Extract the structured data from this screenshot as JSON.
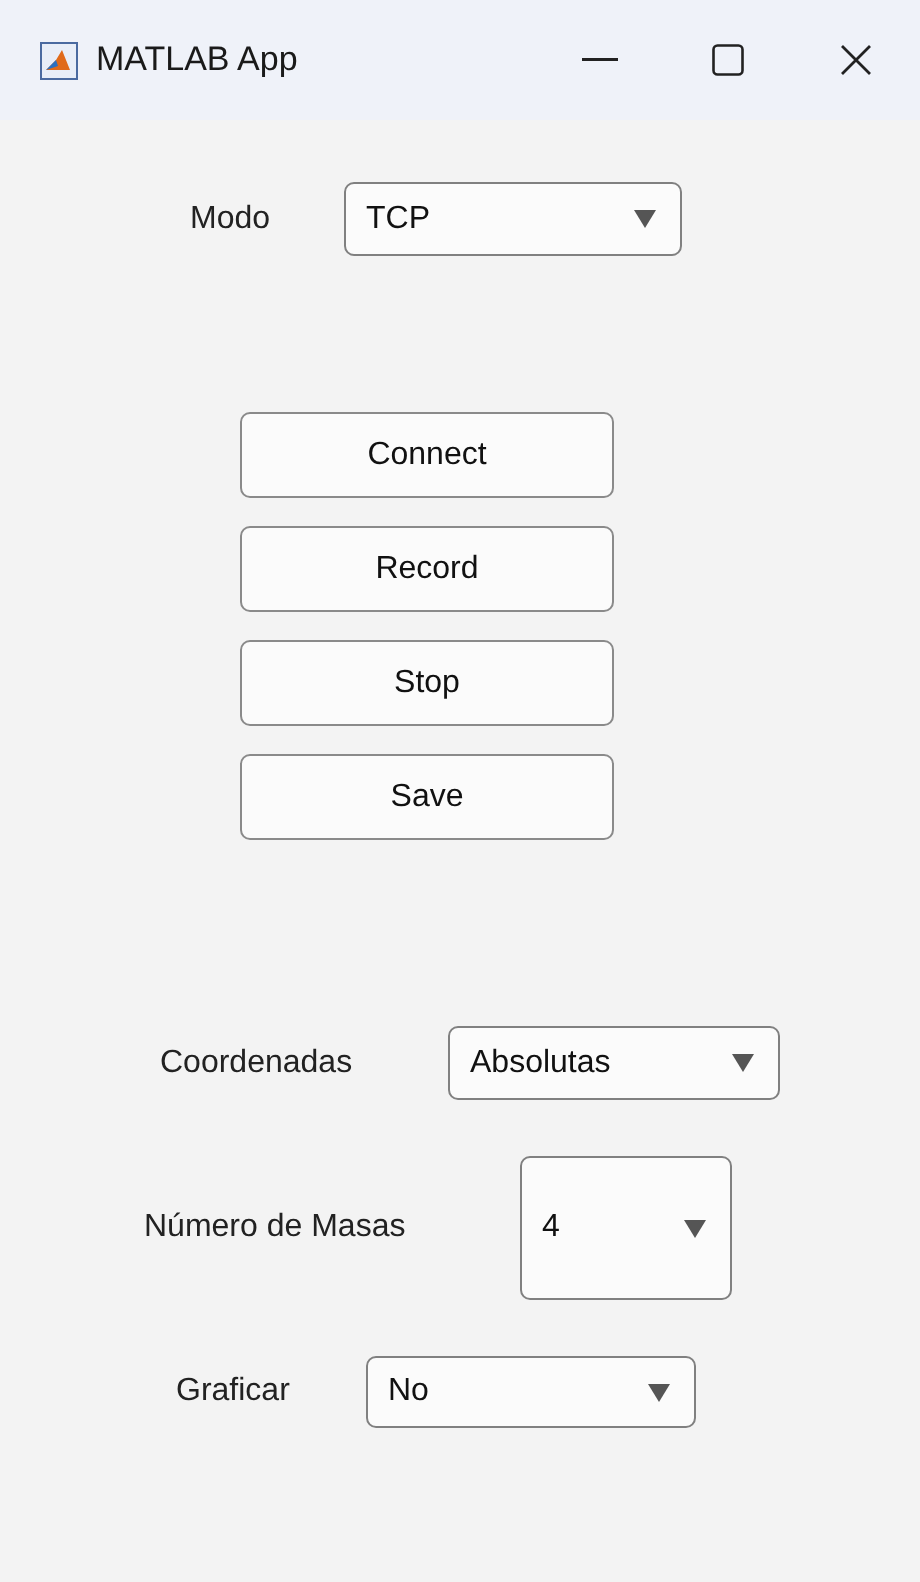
{
  "window": {
    "title": "MATLAB App"
  },
  "mode": {
    "label": "Modo",
    "value": "TCP"
  },
  "buttons": [
    "Connect",
    "Record",
    "Stop",
    "Save"
  ],
  "settings": [
    {
      "label": "Coordenadas",
      "value": "Absolutas"
    },
    {
      "label": "Número de Masas",
      "value": "4"
    },
    {
      "label": "Graficar",
      "value": "No"
    }
  ]
}
